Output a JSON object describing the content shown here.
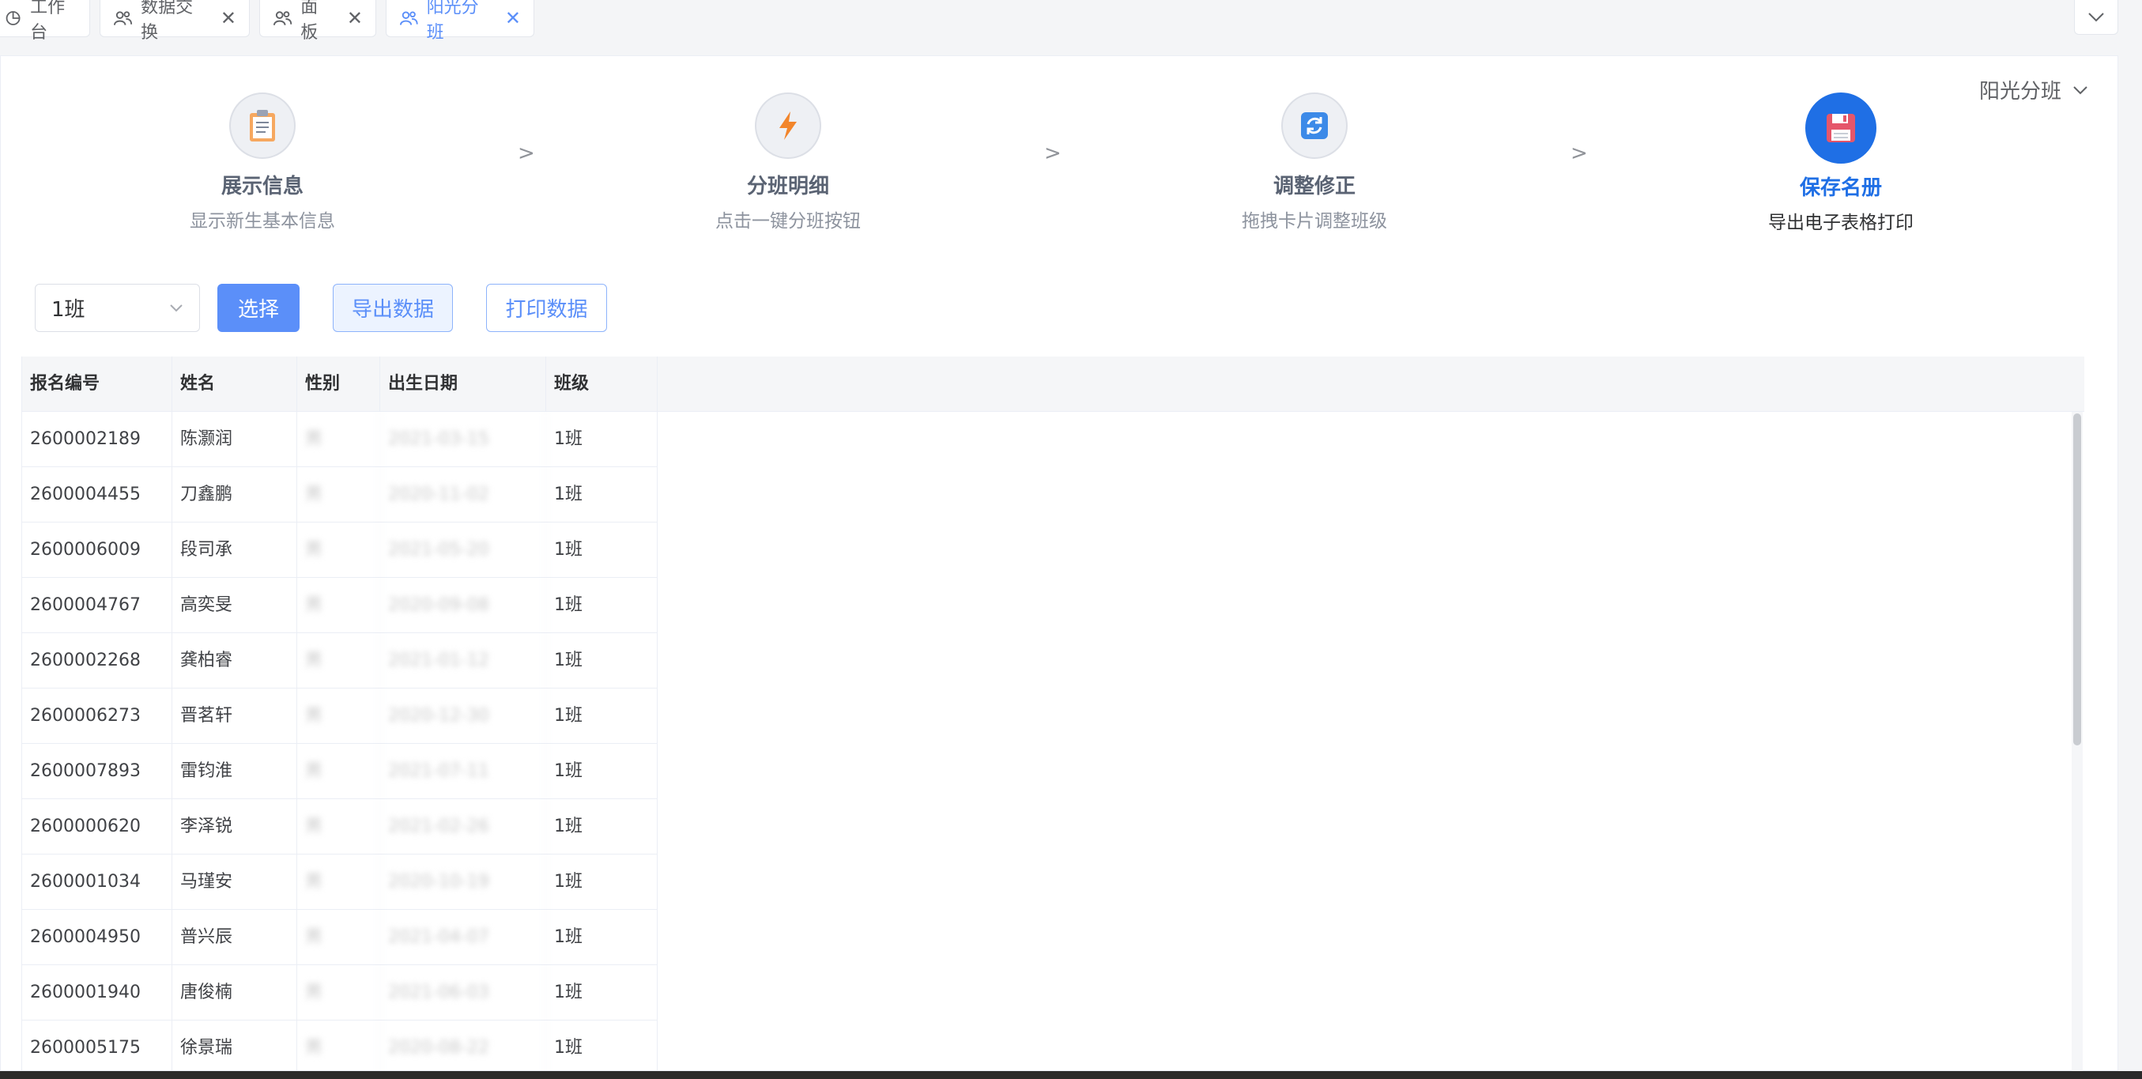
{
  "tabs": [
    {
      "label": "工作台",
      "icon": "pie-chart-icon"
    },
    {
      "label": "数据交换",
      "icon": "people-icon"
    },
    {
      "label": "面板",
      "icon": "people-icon"
    },
    {
      "label": "阳光分班",
      "icon": "people-icon",
      "active": true
    }
  ],
  "header": {
    "class_picker_label": "阳光分班"
  },
  "steps": [
    {
      "title": "展示信息",
      "desc": "显示新生基本信息",
      "icon": "clipboard-icon"
    },
    {
      "title": "分班明细",
      "desc": "点击一键分班按钮",
      "icon": "lightning-icon"
    },
    {
      "title": "调整修正",
      "desc": "拖拽卡片调整班级",
      "icon": "refresh-icon"
    },
    {
      "title": "保存名册",
      "desc": "导出电子表格打印",
      "icon": "floppy-disk-icon",
      "active": true
    }
  ],
  "step_separator": ">",
  "toolbar": {
    "class_select_value": "1班",
    "select_button": "选择",
    "export_button": "导出数据",
    "print_button": "打印数据"
  },
  "table": {
    "columns": [
      "报名编号",
      "姓名",
      "性别",
      "出生日期",
      "班级"
    ],
    "rows": [
      {
        "id": "2600002189",
        "name": "陈灏润",
        "gender": "男",
        "birth": "2021-03-15",
        "class": "1班"
      },
      {
        "id": "2600004455",
        "name": "刀鑫鹏",
        "gender": "男",
        "birth": "2020-11-02",
        "class": "1班"
      },
      {
        "id": "2600006009",
        "name": "段司承",
        "gender": "男",
        "birth": "2021-05-20",
        "class": "1班"
      },
      {
        "id": "2600004767",
        "name": "高奕旻",
        "gender": "男",
        "birth": "2020-09-08",
        "class": "1班"
      },
      {
        "id": "2600002268",
        "name": "龚柏睿",
        "gender": "男",
        "birth": "2021-01-12",
        "class": "1班"
      },
      {
        "id": "2600006273",
        "name": "晋茗轩",
        "gender": "男",
        "birth": "2020-12-30",
        "class": "1班"
      },
      {
        "id": "2600007893",
        "name": "雷钧淮",
        "gender": "男",
        "birth": "2021-07-11",
        "class": "1班"
      },
      {
        "id": "2600000620",
        "name": "李泽锐",
        "gender": "男",
        "birth": "2021-02-26",
        "class": "1班"
      },
      {
        "id": "2600001034",
        "name": "马瑾安",
        "gender": "男",
        "birth": "2020-10-19",
        "class": "1班"
      },
      {
        "id": "2600004950",
        "name": "普兴辰",
        "gender": "男",
        "birth": "2021-04-07",
        "class": "1班"
      },
      {
        "id": "2600001940",
        "name": "唐俊楠",
        "gender": "男",
        "birth": "2021-06-03",
        "class": "1班"
      },
      {
        "id": "2600005175",
        "name": "徐景瑞",
        "gender": "男",
        "birth": "2020-08-22",
        "class": "1班"
      }
    ]
  },
  "colors": {
    "accent": "#5b8ff9",
    "step_active": "#1f6fe5",
    "header_bg": "#f5f6f8"
  }
}
